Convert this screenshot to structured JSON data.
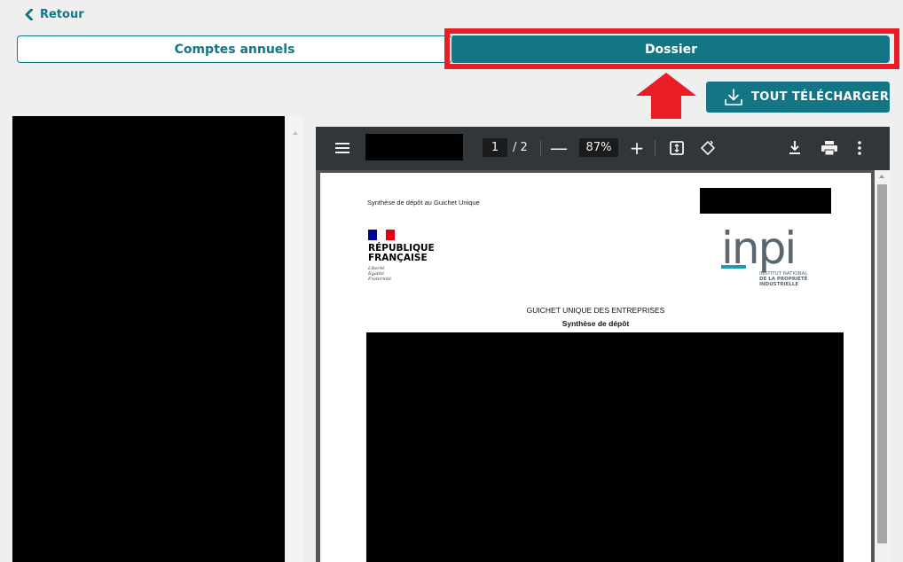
{
  "nav": {
    "back_label": "Retour"
  },
  "tabs": [
    {
      "label": "Comptes annuels",
      "active": false
    },
    {
      "label": "Dossier",
      "active": true
    }
  ],
  "actions": {
    "download_all_label": "TOUT TÉLÉCHARGER"
  },
  "pdf_viewer": {
    "current_page": "1",
    "total_pages": "/ 2",
    "zoom": "87%",
    "zoom_out_symbol": "—",
    "zoom_in_symbol": "+"
  },
  "document": {
    "header_text": "Synthèse de dépôt au Guichet Unique",
    "republique_name": [
      "RÉPUBLIQUE",
      "FRANÇAISE"
    ],
    "motto": [
      "Liberté",
      "Égalité",
      "Fraternité"
    ],
    "inpi_wordmark": "inpi",
    "inpi_lines": [
      "INSTITUT NATIONAL",
      "DE LA PROPRIÉTÉ",
      "INDUSTRIELLE"
    ],
    "title": "GUICHET UNIQUE DES ENTREPRISES",
    "subtitle": "Synthèse de dépôt"
  },
  "colors": {
    "brand_teal": "#147684",
    "highlight_red": "#e81d25",
    "viewer_toolbar": "#323639",
    "flag_blue": "#000091",
    "flag_red": "#e1000f"
  },
  "icons": {
    "back": "chevron-left-icon",
    "download_all": "download-tray-icon",
    "annotation_arrow": "arrow-up-icon",
    "menu": "hamburger-menu-icon",
    "fit": "fit-page-icon",
    "rotate": "rotate-icon",
    "download": "download-icon",
    "print": "print-icon",
    "more": "more-vertical-icon"
  }
}
